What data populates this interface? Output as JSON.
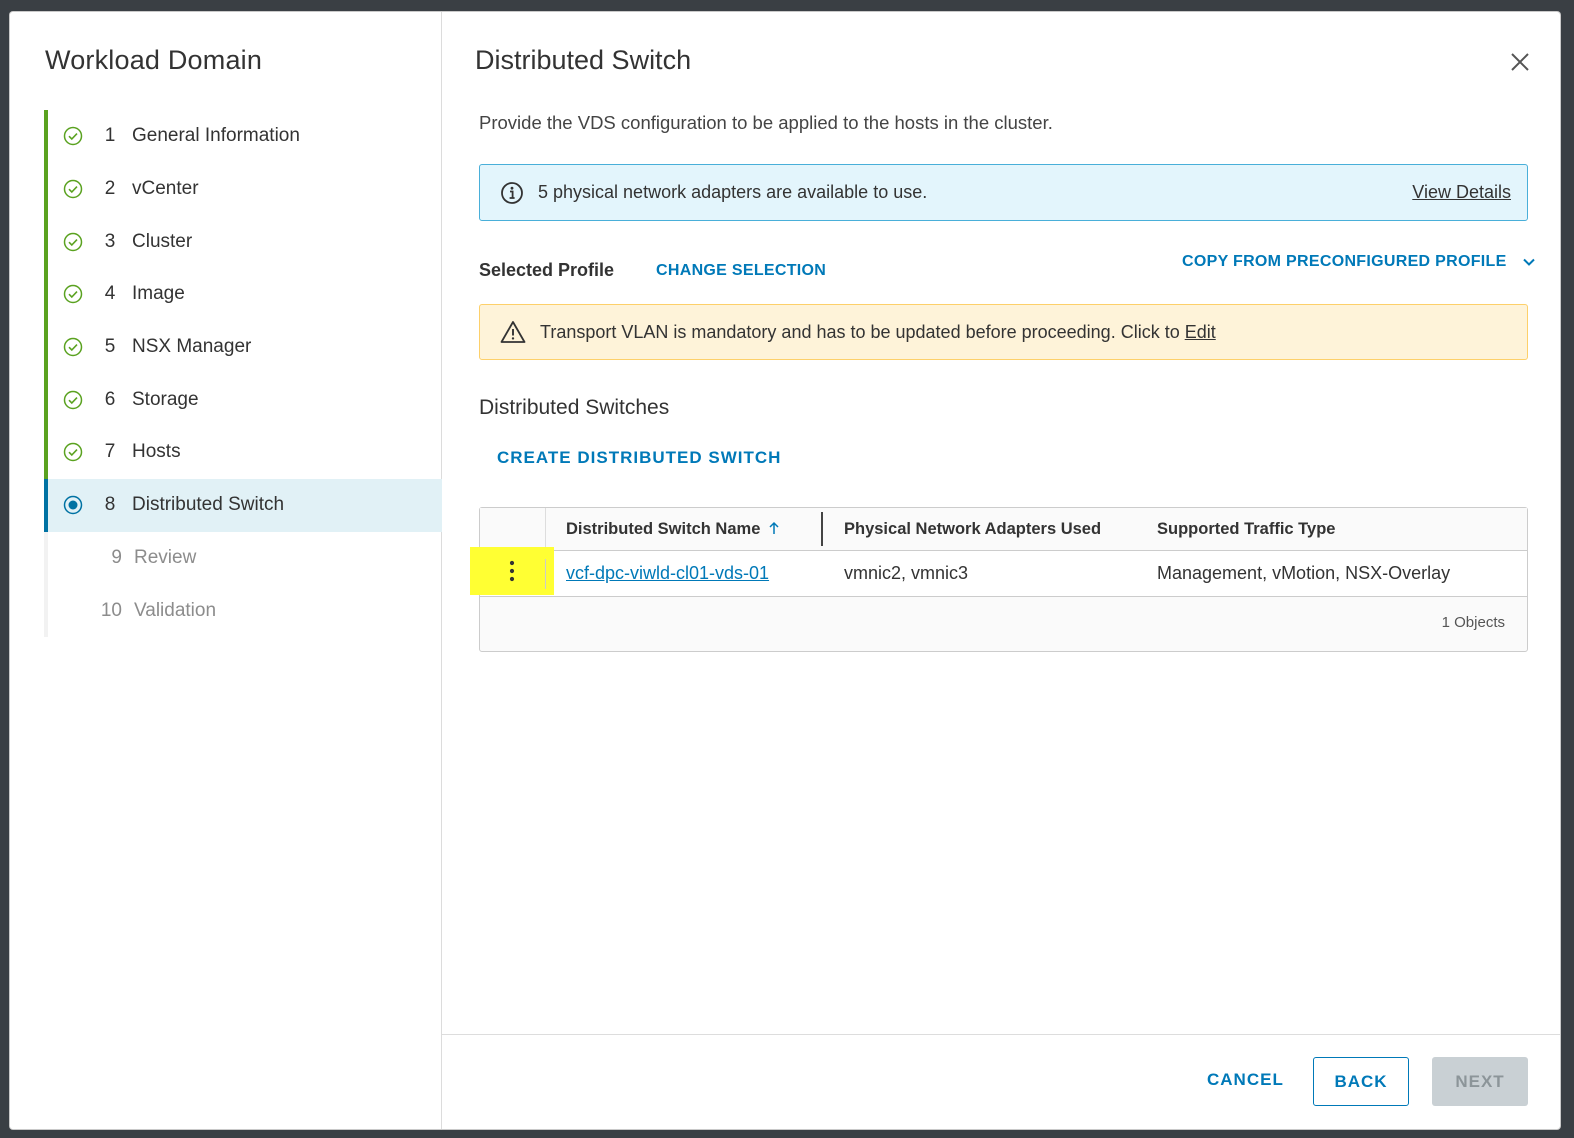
{
  "sidebar": {
    "title": "Workload Domain",
    "steps": [
      {
        "num": "1",
        "label": "General Information",
        "state": "done"
      },
      {
        "num": "2",
        "label": "vCenter",
        "state": "done"
      },
      {
        "num": "3",
        "label": "Cluster",
        "state": "done"
      },
      {
        "num": "4",
        "label": "Image",
        "state": "done"
      },
      {
        "num": "5",
        "label": "NSX Manager",
        "state": "done"
      },
      {
        "num": "6",
        "label": "Storage",
        "state": "done"
      },
      {
        "num": "7",
        "label": "Hosts",
        "state": "done"
      },
      {
        "num": "8",
        "label": "Distributed Switch",
        "state": "current"
      },
      {
        "num": "9",
        "label": "Review",
        "state": "pending"
      },
      {
        "num": "10",
        "label": "Validation",
        "state": "pending"
      }
    ]
  },
  "main": {
    "title": "Distributed Switch",
    "description": "Provide the VDS configuration to be applied to the hosts in the cluster.",
    "info_banner": {
      "text": "5 physical network adapters are available to use.",
      "link": "View Details"
    },
    "profile": {
      "label": "Selected Profile",
      "change_label": "CHANGE SELECTION",
      "copy_label": "COPY FROM PRECONFIGURED PROFILE"
    },
    "warning_banner": {
      "text": "Transport VLAN is mandatory and has to be updated before proceeding. Click to",
      "link": "Edit"
    },
    "section_title": "Distributed Switches",
    "create_label": "CREATE DISTRIBUTED SWITCH",
    "grid": {
      "columns": [
        "Distributed Switch Name",
        "Physical Network Adapters Used",
        "Supported Traffic Type"
      ],
      "rows": [
        {
          "name": "vcf-dpc-viwld-cl01-vds-01",
          "adapters": "vmnic2, vmnic3",
          "traffic": "Management, vMotion, NSX-Overlay"
        }
      ],
      "footer": "1 Objects"
    }
  },
  "footer": {
    "cancel": "CANCEL",
    "back": "BACK",
    "next": "NEXT"
  },
  "colors": {
    "accent": "#0079b8",
    "success": "#5aa220",
    "highlight": "#ffff33",
    "annotation_arrow": "#f0a30a"
  }
}
